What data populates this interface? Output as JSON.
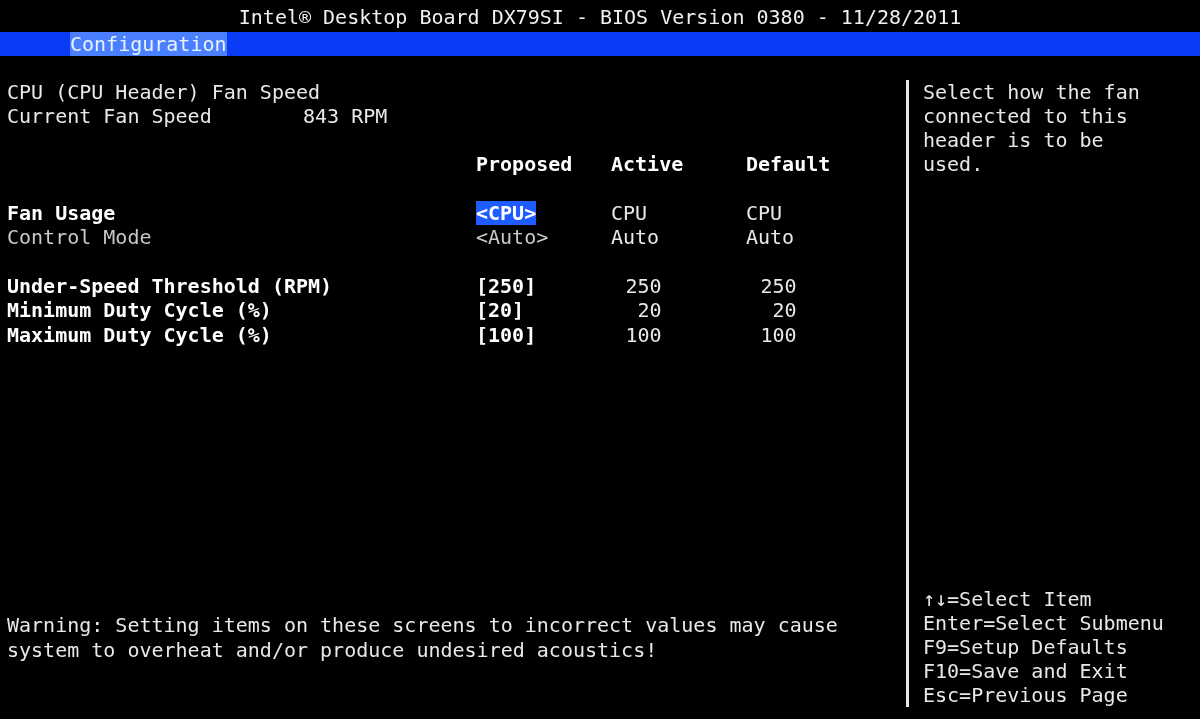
{
  "window": {
    "title": "Intel® Desktop Board DX79SI - BIOS Version 0380 - 11/28/2011"
  },
  "tabs": [
    {
      "label": "Configuration",
      "selected": true
    }
  ],
  "page": {
    "title": "CPU (CPU Header) Fan Speed",
    "current_speed": {
      "label": "Current Fan Speed",
      "value": "843 RPM"
    }
  },
  "table": {
    "columns": [
      "Proposed",
      "Active",
      "Default"
    ],
    "groups": [
      {
        "rows": [
          {
            "label": "Fan Usage",
            "kind": "option",
            "proposed": "<CPU>",
            "active": "CPU",
            "default": "CPU",
            "selected": true,
            "disabled": false
          },
          {
            "label": "Control Mode",
            "kind": "option",
            "proposed": "<Auto>",
            "active": "Auto",
            "default": "Auto",
            "selected": false,
            "disabled": true
          }
        ]
      },
      {
        "rows": [
          {
            "label": "Under-Speed Threshold (RPM)",
            "kind": "number",
            "proposed": "[250]",
            "active": "250",
            "default": "250",
            "selected": false,
            "disabled": false
          },
          {
            "label": "Minimum Duty Cycle (%)",
            "kind": "number",
            "proposed": "[20]",
            "active": "20",
            "default": "20",
            "selected": false,
            "disabled": false
          },
          {
            "label": "Maximum Duty Cycle (%)",
            "kind": "number",
            "proposed": "[100]",
            "active": "100",
            "default": "100",
            "selected": false,
            "disabled": false
          }
        ]
      }
    ]
  },
  "warning": "Warning: Setting items on these screens to incorrect values may cause system to overheat and/or produce undesired acoustics!",
  "help": "Select how the fan connected to this header is to be used.",
  "keys": [
    "↑↓=Select Item",
    "Enter=Select Submenu",
    "F9=Setup Defaults",
    "F10=Save and Exit",
    "Esc=Previous Page"
  ]
}
